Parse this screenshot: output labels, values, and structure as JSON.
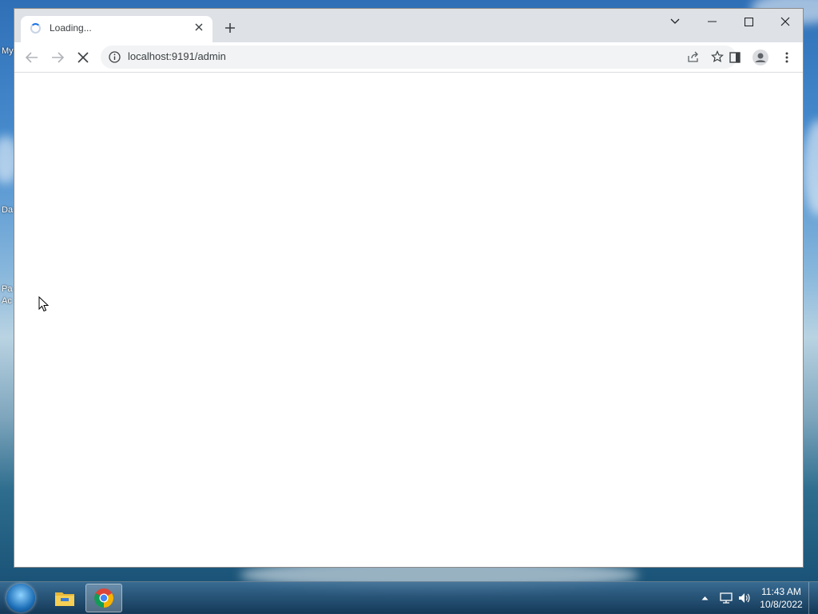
{
  "desktop": {
    "icon_labels": [
      "My",
      "Da",
      "Pa",
      "Ac"
    ]
  },
  "browser": {
    "tab": {
      "title": "Loading...",
      "close_icon": "close-icon",
      "spinner_icon": "loading-spinner-icon"
    },
    "new_tab_icon": "plus-icon",
    "window_controls": {
      "tab_search_icon": "chevron-down-icon",
      "minimize_icon": "minimize-icon",
      "maximize_icon": "maximize-icon",
      "close_icon": "close-icon"
    },
    "toolbar": {
      "back_icon": "back-arrow-icon",
      "forward_icon": "forward-arrow-icon",
      "stop_icon": "stop-icon",
      "site_info_icon": "info-icon",
      "url": "localhost:9191/admin",
      "share_icon": "share-icon",
      "bookmark_icon": "star-icon",
      "side_panel_icon": "side-panel-icon",
      "profile_icon": "profile-icon",
      "menu_icon": "kebab-menu-icon"
    }
  },
  "taskbar": {
    "start_icon": "windows-start-icon",
    "apps": [
      {
        "name": "File Explorer",
        "icon": "folder-icon",
        "active": false
      },
      {
        "name": "Google Chrome",
        "icon": "chrome-icon",
        "active": true
      }
    ],
    "tray": {
      "show_hidden_icon": "caret-up-icon",
      "network_icon": "network-icon",
      "volume_icon": "volume-icon"
    },
    "clock": {
      "time": "11:43 AM",
      "date": "10/8/2022"
    }
  },
  "colors": {
    "tabstrip_bg": "#dee1e6",
    "omnibox_bg": "#f1f3f4",
    "spinner_accent": "#1a73e8",
    "taskbar_bg": "#244e73"
  }
}
